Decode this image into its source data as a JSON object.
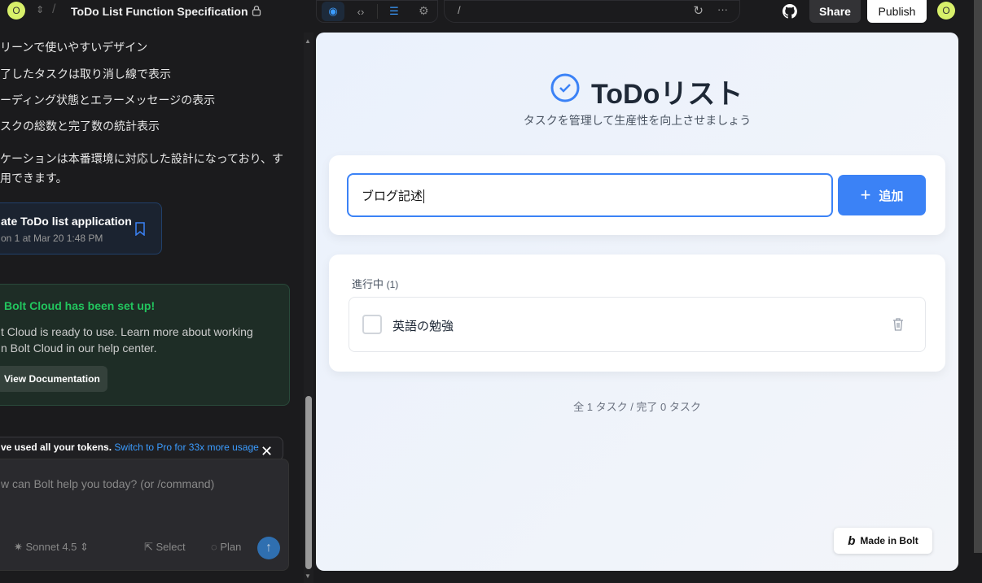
{
  "header": {
    "avatar": "O",
    "project_title": "ToDo List Function Specification",
    "url": "/",
    "share": "Share",
    "publish": "Publish",
    "user_avatar": "O"
  },
  "chat": {
    "lines": [
      "リーンで使いやすいデザイン",
      "了したタスクは取り消し線で表示",
      "ーディング状態とエラーメッセージの表示",
      "スクの総数と完了数の統計表示",
      "ケーションは本番環境に対応した設計になっており、す",
      "用できます。"
    ],
    "commit": {
      "title": "ate ToDo list application",
      "subtitle": "on 1 at Mar 20 1:48 PM"
    },
    "cloud": {
      "title": "Bolt Cloud has been set up!",
      "body1": "t Cloud is ready to use. Learn more about working",
      "body2": "n Bolt Cloud in our help center.",
      "button": "View Documentation"
    },
    "tokens": {
      "text": "ve used all your tokens.",
      "link": "Switch to Pro for 33x more usage"
    },
    "input": {
      "placeholder": "w can Bolt help you today? (or /command)",
      "model": "Sonnet 4.5",
      "select": "Select",
      "plan": "Plan"
    }
  },
  "app": {
    "title": "ToDoリスト",
    "subtitle": "タスクを管理して生産性を向上させましょう",
    "input_value": "ブログ記述",
    "add_button": "追加",
    "section": "進行中",
    "section_count": "(1)",
    "tasks": [
      {
        "text": "英語の勉強",
        "done": false
      }
    ],
    "stats": "全 1 タスク / 完了 0 タスク",
    "badge": "Made in Bolt"
  },
  "colors": {
    "accent": "#3b82f6",
    "green": "#22c55e"
  }
}
